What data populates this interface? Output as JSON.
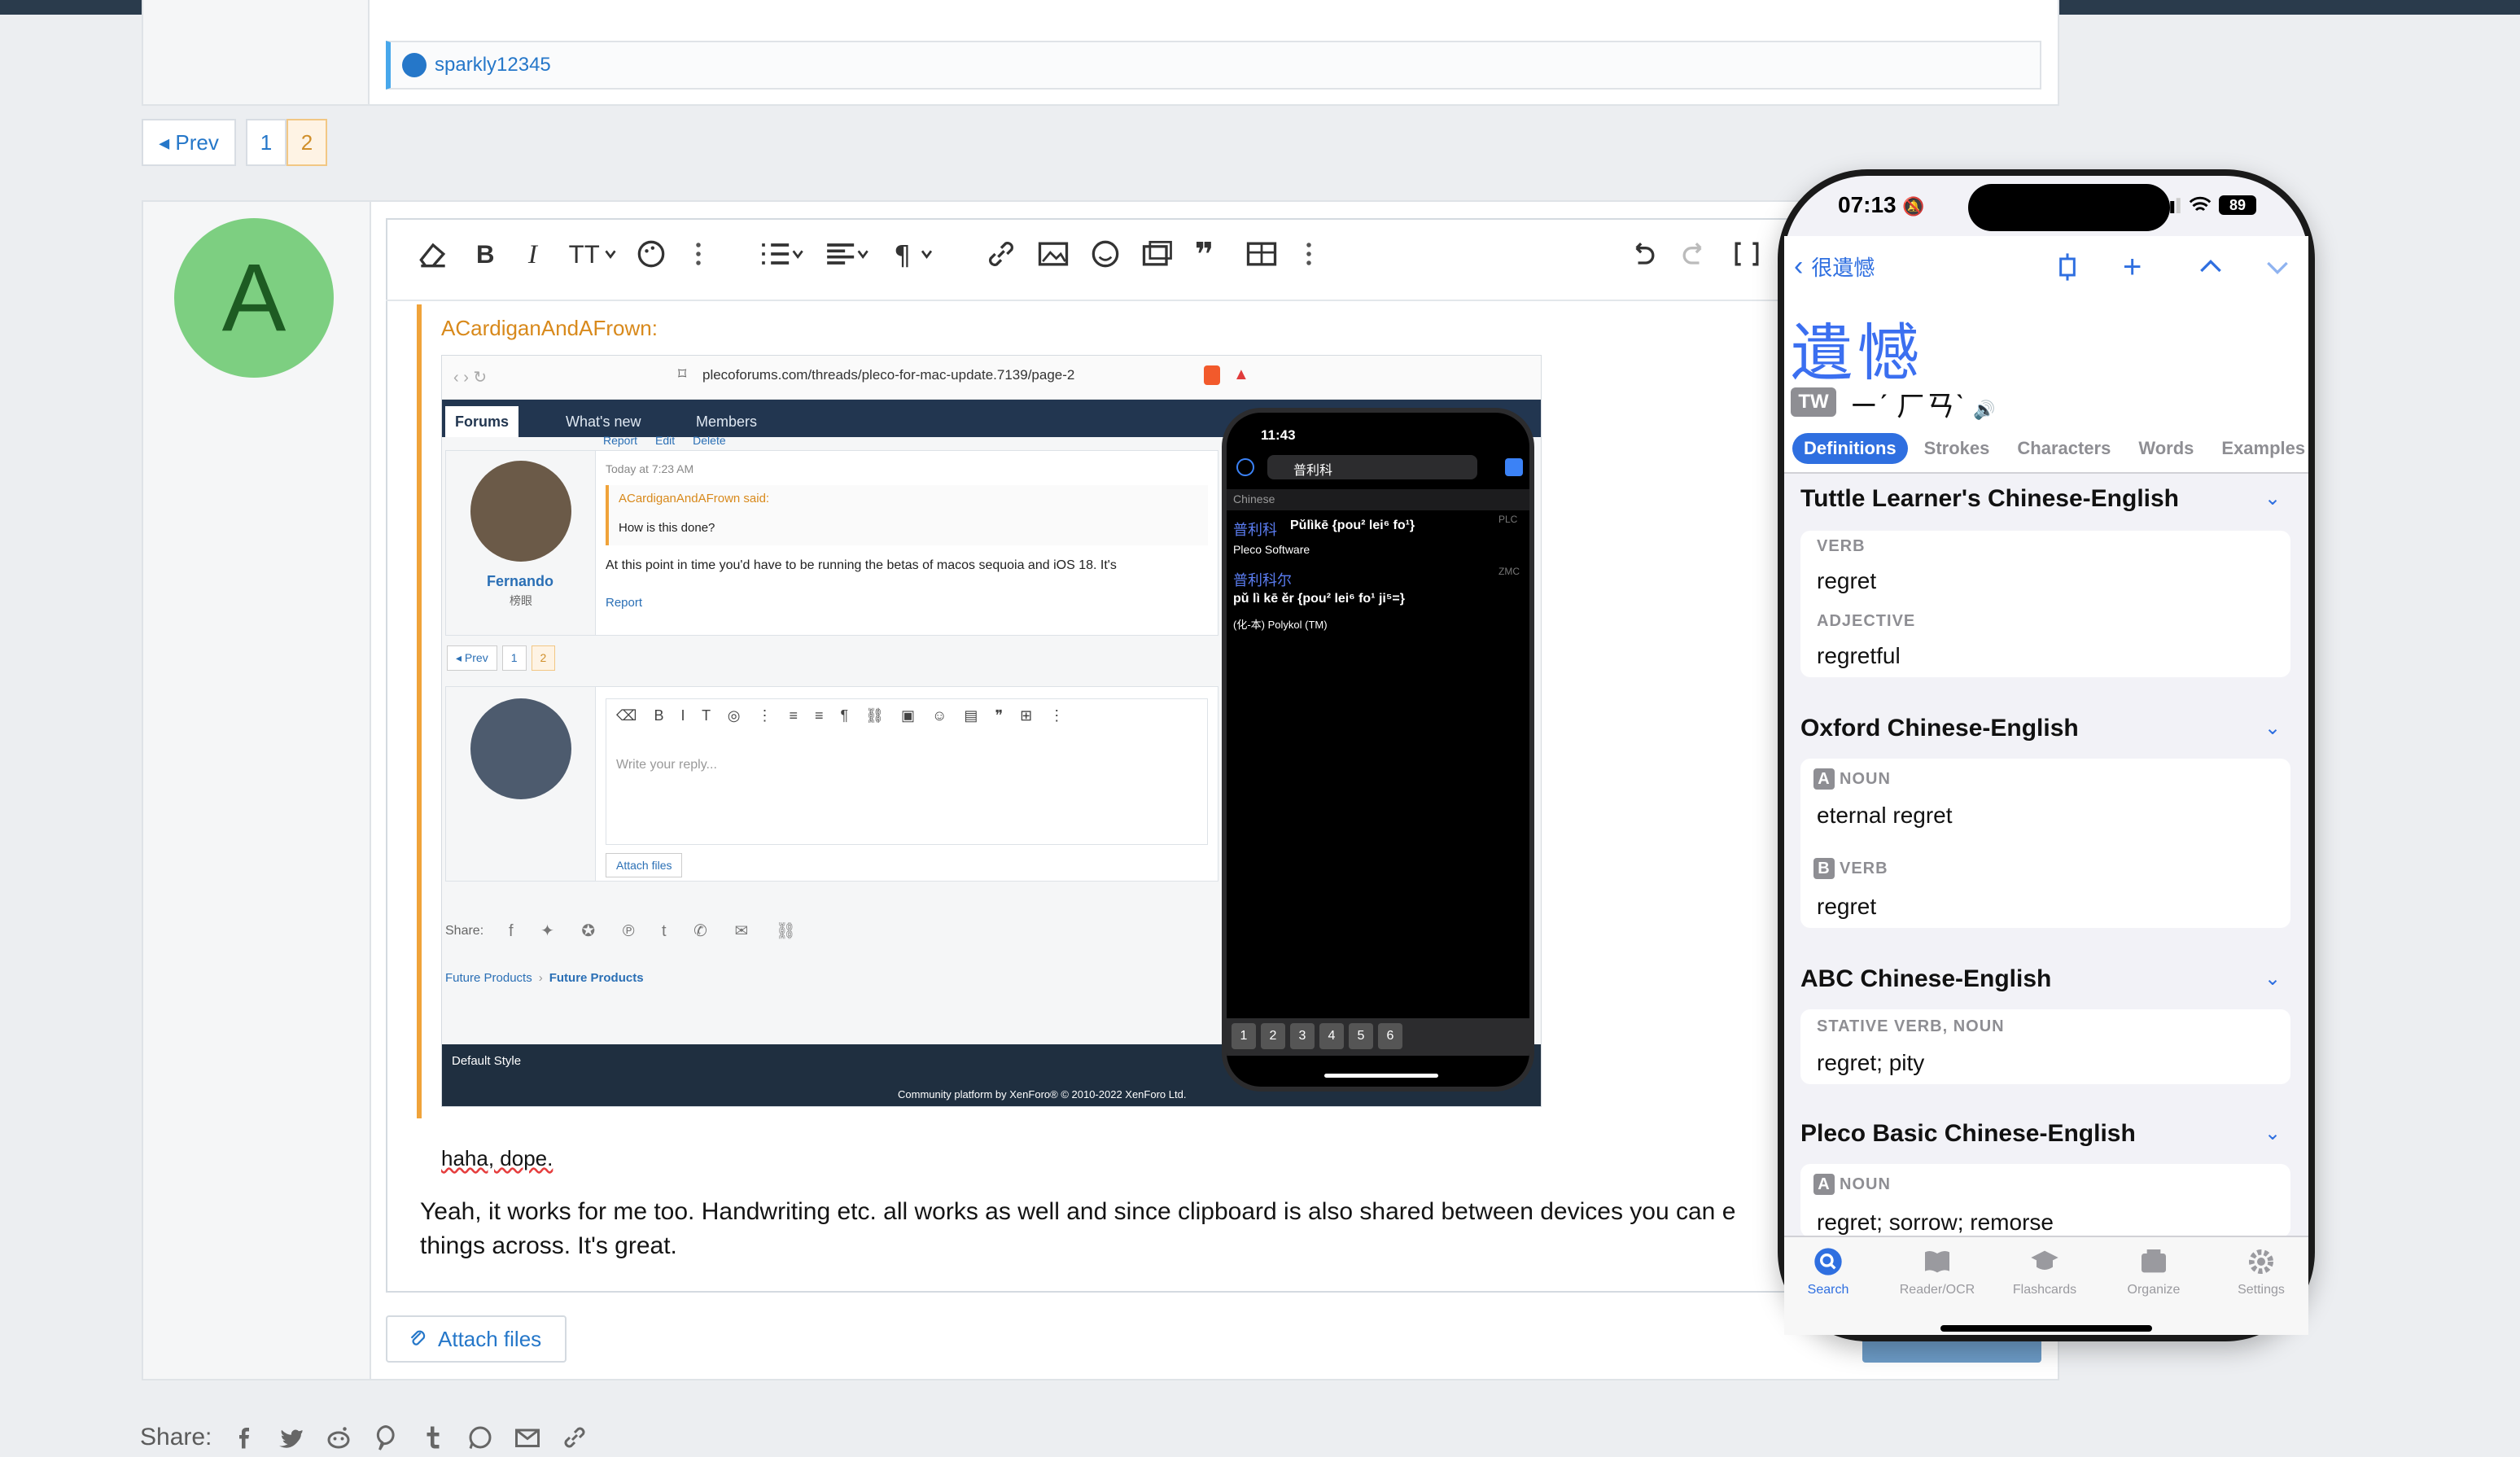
{
  "reaction": {
    "user": "sparkly12345"
  },
  "pagination": {
    "prev": "◂ Prev",
    "pages": [
      "1",
      "2"
    ],
    "current": "2"
  },
  "reply_avatar_letter": "A",
  "quote": {
    "author": "ACardiganAndAFrown:"
  },
  "embedded_screenshot": {
    "url": "plecoforums.com/threads/pleco-for-mac-update.7139/page-2",
    "nav": [
      "Forums",
      "What's new",
      "Members"
    ],
    "post_actions": [
      "Report",
      "Edit",
      "Delete"
    ],
    "post_time": "Today at 7:23 AM",
    "quote_author": "ACardiganAndAFrown said:",
    "quote_text": "How is this done?",
    "post_user": "Fernando",
    "post_user_title": "榜眼",
    "post_text": "At this point in time you'd have to be running the betas of macos sequoia and iOS 18. It's",
    "report": "Report",
    "pages": [
      "◂ Prev",
      "1",
      "2"
    ],
    "editor_placeholder": "Write your reply...",
    "attach": "Attach files",
    "share_label": "Share:",
    "breadcrumb": [
      "Future Products",
      "Future Products"
    ],
    "footer_style": "Default Style",
    "footer_copyright": "Community platform by XenForo® © 2010-2022 XenForo Ltd.",
    "phone": {
      "time": "11:43",
      "search": "普利科",
      "section": "Chinese",
      "r1_hanzi": "普利科",
      "r1_text": "Pǔlìkē {pou² lei⁶ fo¹}",
      "r1_sub": "Pleco Software",
      "r1_tag": "PLC",
      "r2_hanzi": "普利科尔",
      "r2_text": "pǔ lì kē ěr {pou² lei⁶ fo¹ ji⁵=}",
      "r2_sub": "(化-本) Polykol (TM)",
      "r2_tag": "ZMC",
      "keys": [
        "1",
        "2",
        "3",
        "4",
        "5",
        "6"
      ]
    }
  },
  "reply_line": "haha, dope.",
  "reply_text": "Yeah, it works for me too. Handwriting etc. all works as well and since clipboard is also shared between devices you can e things across. It's great.",
  "attach_files": "Attach files",
  "share_label": "Share:",
  "pleco": {
    "time": "07:13",
    "battery": "89",
    "back_label": "很遺憾",
    "headword": "遺憾",
    "tw_badge": "TW",
    "zhuyin": "ㄧˊ ㄏㄢˋ",
    "tabs": [
      "Definitions",
      "Strokes",
      "Characters",
      "Words",
      "Examples"
    ],
    "dicts": [
      {
        "name": "Tuttle Learner's Chinese-English",
        "entries": [
          {
            "pos": "VERB",
            "def": "regret"
          },
          {
            "pos": "ADJECTIVE",
            "def": "regretful"
          }
        ]
      },
      {
        "name": "Oxford Chinese-English",
        "entries": [
          {
            "badge": "A",
            "pos": "NOUN",
            "def": "eternal regret"
          },
          {
            "badge": "B",
            "pos": "VERB",
            "def": "regret"
          }
        ]
      },
      {
        "name": "ABC Chinese-English",
        "entries": [
          {
            "pos": "STATIVE VERB, NOUN",
            "def": "regret; pity"
          }
        ]
      },
      {
        "name": "Pleco Basic Chinese-English",
        "entries": [
          {
            "badge": "A",
            "pos": "NOUN",
            "def": "regret; sorrow; remorse"
          }
        ]
      }
    ],
    "tabbar": [
      "Search",
      "Reader/OCR",
      "Flashcards",
      "Organize",
      "Settings"
    ]
  },
  "colors": {
    "accent": "#2577c9",
    "quote": "#f0a33a",
    "pleco_blue": "#2f6fe0",
    "avatar": "#7dcf81"
  }
}
